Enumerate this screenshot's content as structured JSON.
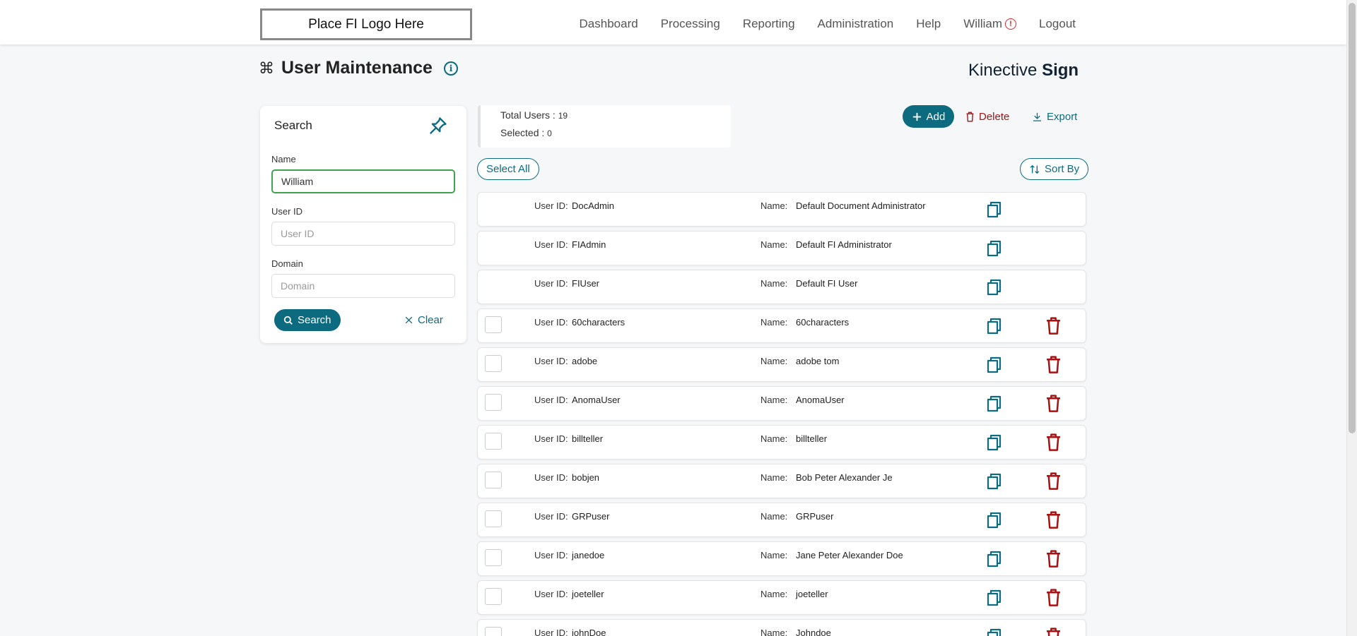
{
  "header": {
    "logo_text": "Place FI Logo Here",
    "nav": [
      "Dashboard",
      "Processing",
      "Reporting",
      "Administration",
      "Help"
    ],
    "user_name": "William",
    "logout": "Logout"
  },
  "page": {
    "title": "User Maintenance",
    "brand_light": "Kinective ",
    "brand_bold": "Sign"
  },
  "search": {
    "title": "Search",
    "name_label": "Name",
    "name_value": "William",
    "userid_label": "User ID",
    "userid_placeholder": "User ID",
    "domain_label": "Domain",
    "domain_placeholder": "Domain",
    "search_label": "Search",
    "clear_label": "Clear"
  },
  "stats": {
    "total_label": "Total Users : ",
    "total_value": "19",
    "selected_label": "Selected : ",
    "selected_value": "0"
  },
  "actions": {
    "add": "Add",
    "delete": "Delete",
    "export": "Export",
    "select_all": "Select All",
    "sort_by": "Sort By"
  },
  "list": {
    "userid_label": "User ID:",
    "name_label": "Name:"
  },
  "users": [
    {
      "id": "DocAdmin",
      "name": "Default Document Administrator",
      "system": true
    },
    {
      "id": "FIAdmin",
      "name": "Default FI Administrator",
      "system": true
    },
    {
      "id": "FIUser",
      "name": "Default FI User",
      "system": true
    },
    {
      "id": "60characters",
      "name": "60characters",
      "system": false
    },
    {
      "id": "adobe",
      "name": "adobe tom",
      "system": false
    },
    {
      "id": "AnomaUser",
      "name": "AnomaUser",
      "system": false
    },
    {
      "id": "billteller",
      "name": "billteller",
      "system": false
    },
    {
      "id": "bobjen",
      "name": "Bob Peter Alexander Je",
      "system": false
    },
    {
      "id": "GRPuser",
      "name": "GRPuser",
      "system": false
    },
    {
      "id": "janedoe",
      "name": "Jane Peter Alexander Doe",
      "system": false
    },
    {
      "id": "joeteller",
      "name": "joeteller",
      "system": false
    },
    {
      "id": "johnDoe",
      "name": "Johndoe",
      "system": false
    }
  ],
  "colors": {
    "primary": "#0d6b80",
    "danger": "#a11",
    "focus_border": "#3fa34d"
  }
}
